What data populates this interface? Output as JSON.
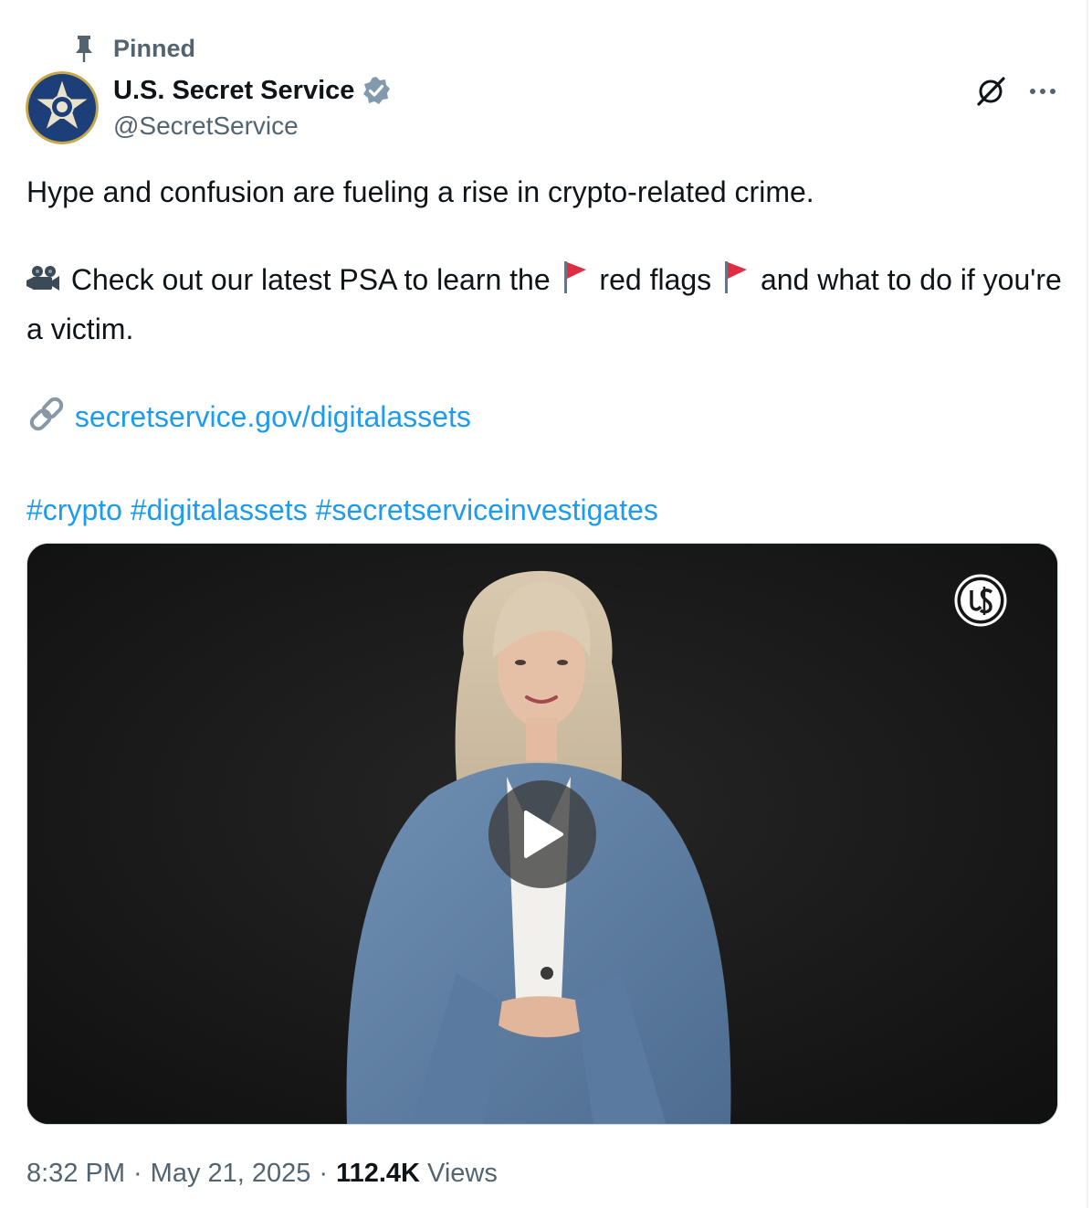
{
  "pinned": {
    "label": "Pinned",
    "icon": "pin-icon"
  },
  "author": {
    "display_name": "U.S. Secret Service",
    "handle": "@SecretService",
    "verified_icon": "verified-badge-icon",
    "avatar_icon": "secret-service-star-badge"
  },
  "header_actions": {
    "grok_icon": "grok-icon",
    "more_icon": "more-options-icon"
  },
  "tweet": {
    "line1": "Hype and confusion are fueling a rise in crypto-related crime.",
    "line2_part1": "Check out our latest PSA to learn the",
    "line2_part2": "red flags",
    "line2_part3": "and what to do if you're a victim.",
    "link_text": "secretservice.gov/digitalassets",
    "hashtags": [
      "#crypto",
      "#digitalassets",
      "#secretserviceinvestigates"
    ],
    "emojis": {
      "camera": "movie-camera-emoji",
      "flag": "red-flag-emoji",
      "link": "link-emoji"
    }
  },
  "video": {
    "play_icon": "play-icon",
    "watermark_icon": "usss-logo-icon"
  },
  "meta": {
    "time": "8:32 PM",
    "separator": "·",
    "date": "May 21, 2025",
    "views_count": "112.4K",
    "views_label": "Views"
  },
  "colors": {
    "link": "#1d9bf0",
    "secondary_text": "#536471",
    "primary_text": "#0f1419"
  }
}
